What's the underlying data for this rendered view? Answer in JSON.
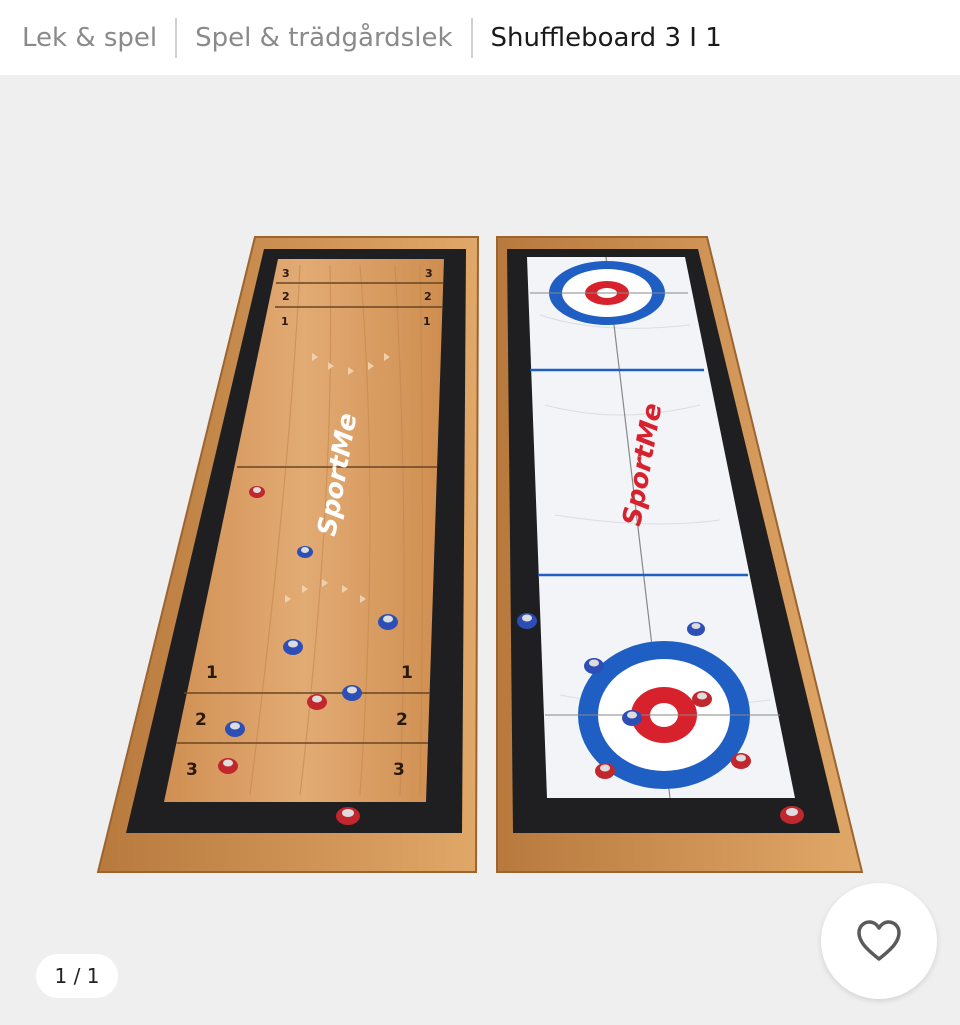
{
  "breadcrumb": {
    "items": [
      "Lek & spel",
      "Spel & trädgårdslek"
    ],
    "current": "Shuffleboard 3 I 1"
  },
  "gallery": {
    "counter": "1 / 1",
    "board_left": {
      "brand": "SportMe",
      "zone_labels_top": [
        "3",
        "2",
        "1"
      ],
      "zone_labels_bottom": [
        "1",
        "2",
        "3"
      ]
    },
    "board_right": {
      "brand": "SportMe"
    }
  },
  "favorite": {
    "icon": "heart-outline-icon"
  },
  "colors": {
    "wood": "#d69a5f",
    "frame": "#c88a4a",
    "felt": "#1f1f22",
    "ice": "#f2f4f7",
    "ring_blue": "#1f5fc4",
    "ring_red": "#d7222d",
    "puck_red": "#c1272d",
    "puck_blue": "#2d4fb5"
  }
}
